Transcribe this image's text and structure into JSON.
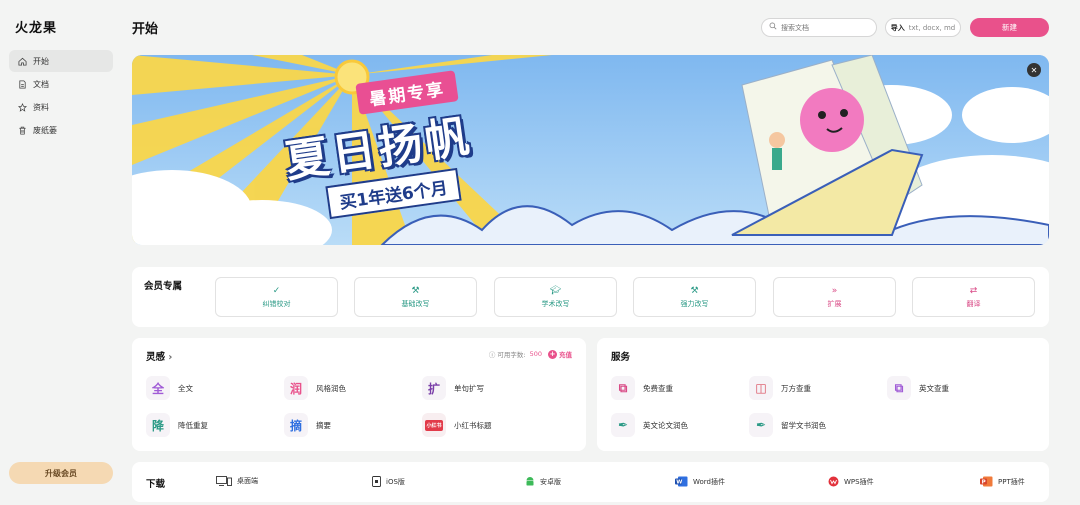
{
  "app": {
    "logo": "火龙果"
  },
  "sidebar": {
    "items": [
      {
        "label": "开始",
        "icon": "home-icon",
        "active": true
      },
      {
        "label": "文档",
        "icon": "document-icon"
      },
      {
        "label": "资料",
        "icon": "star-icon"
      },
      {
        "label": "废纸篓",
        "icon": "trash-icon"
      }
    ],
    "upgrade_label": "升级会员"
  },
  "header": {
    "title": "开始",
    "search_placeholder": "搜索文档",
    "import_label": "导入",
    "import_formats": "txt, docx, md",
    "new_label": "新建",
    "accent": "#e9518b"
  },
  "banner": {
    "tag": "暑期专享",
    "headline": "夏日扬帆",
    "sub": "买1年送6个月"
  },
  "member": {
    "title": "会员专属",
    "buttons": [
      {
        "label": "纠错校对",
        "icon": "check-icon"
      },
      {
        "label": "基础改写",
        "icon": "magic-wand-icon"
      },
      {
        "label": "学术改写",
        "icon": "graduation-cap-icon"
      },
      {
        "label": "强力改写",
        "icon": "magic-wand-icon"
      },
      {
        "label": "扩展",
        "icon": "double-chevron-icon"
      },
      {
        "label": "翻译",
        "icon": "swap-icon"
      }
    ]
  },
  "inspiration": {
    "title": "灵感",
    "wordcount_label": "可用字数:",
    "wordcount_value": "500",
    "recharge_label": "充值",
    "tools": [
      {
        "glyph": "全",
        "label": "全文",
        "color": "#a05bd6"
      },
      {
        "glyph": "润",
        "label": "风格润色",
        "color": "#e9518b"
      },
      {
        "glyph": "扩",
        "label": "单句扩写",
        "color": "#7a3fa8"
      },
      {
        "glyph": "降",
        "label": "降低重复",
        "color": "#2b9a86"
      },
      {
        "glyph": "摘",
        "label": "摘要",
        "color": "#2f6fe0"
      },
      {
        "glyph": "小红书",
        "label": "小红书标题",
        "color": "#e23b4a"
      }
    ]
  },
  "services": {
    "title": "服务",
    "items": [
      {
        "label": "免费查重",
        "icon": "copy-check-icon",
        "color": "#d94a86"
      },
      {
        "label": "万方查重",
        "icon": "grid-icon",
        "color": "#d94a5a"
      },
      {
        "label": "英文查重",
        "icon": "copy-check-icon",
        "color": "#a05bd6"
      },
      {
        "label": "英文论文润色",
        "icon": "pen-nib-icon",
        "color": "#2b9a86"
      },
      {
        "label": "留学文书润色",
        "icon": "pen-nib-icon",
        "color": "#2b9a86"
      }
    ]
  },
  "download": {
    "title": "下载",
    "items": [
      {
        "label": "桌面端",
        "icon": "desktop-icon"
      },
      {
        "label": "iOS版",
        "icon": "ios-icon"
      },
      {
        "label": "安卓版",
        "icon": "android-icon"
      },
      {
        "label": "Word插件",
        "icon": "word-icon"
      },
      {
        "label": "WPS插件",
        "icon": "wps-icon"
      },
      {
        "label": "PPT插件",
        "icon": "ppt-icon"
      }
    ]
  }
}
